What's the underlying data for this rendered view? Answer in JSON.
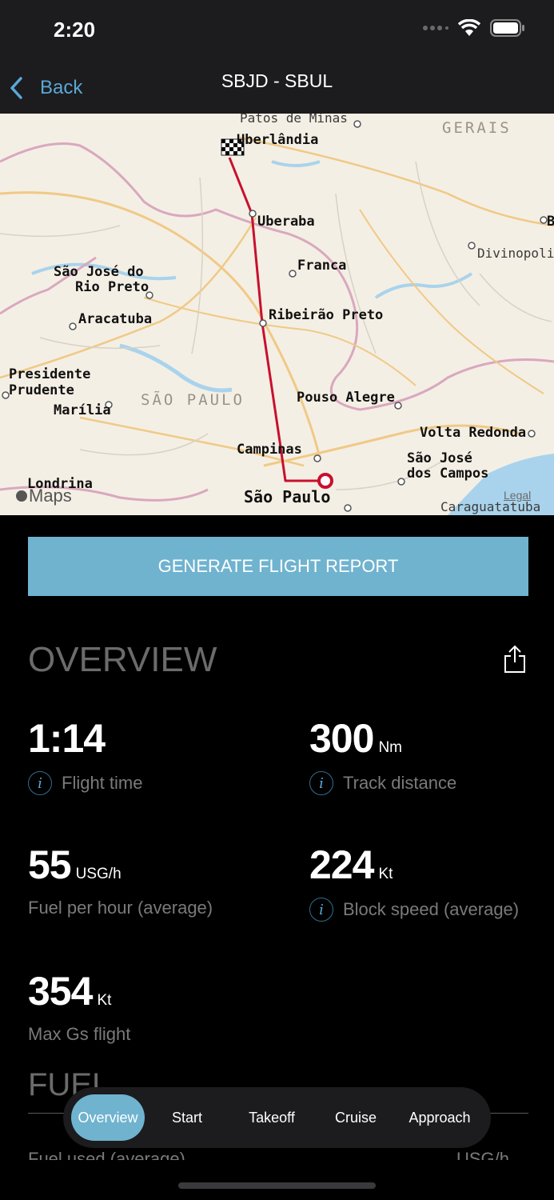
{
  "status_bar": {
    "time": "2:20"
  },
  "nav": {
    "back_label": "Back",
    "title": "SBJD - SBUL"
  },
  "map": {
    "labels": {
      "patos": "Patos de Minas",
      "gerais": "GERAIS",
      "uberlandia": "Uberlândia",
      "uberaba": "Uberaba",
      "divinopolis": "Divinopoli",
      "franca": "Franca",
      "sjrp_1": "São José do",
      "sjrp_2": "Rio Preto",
      "aracatuba": "Aracatuba",
      "ribeirao": "Ribeirão Preto",
      "presidente_1": "Presidente",
      "presidente_2": "Prudente",
      "sao_paulo_state": "SÃO PAULO",
      "pouso": "Pouso Alegre",
      "marilia": "Marília",
      "volta": "Volta Redonda",
      "campinas": "Campinas",
      "sjc_1": "São José",
      "sjc_2": "dos Campos",
      "londrina": "Londrina",
      "sao_paulo": "São Paulo",
      "caraguatatuba": "Caraguatatuba",
      "b_edge": "B"
    },
    "attribution": "Maps",
    "legal": "Legal"
  },
  "report_button": "GENERATE FLIGHT REPORT",
  "overview": {
    "title": "OVERVIEW",
    "stats": {
      "flight_time": {
        "value": "1:14",
        "label": "Flight time"
      },
      "track_distance": {
        "value": "300",
        "unit": "Nm",
        "label": "Track distance"
      },
      "fuel_per_hour": {
        "value": "55",
        "unit": "USG/h",
        "label": "Fuel per hour (average)"
      },
      "block_speed": {
        "value": "224",
        "unit": "Kt",
        "label": "Block speed (average)"
      },
      "max_gs": {
        "value": "354",
        "unit": "Kt",
        "label": "Max Gs flight"
      }
    }
  },
  "fuel": {
    "title": "FUEL",
    "row_label": "Fuel used (average)",
    "row_value": "USG/h"
  },
  "tabs": [
    "Overview",
    "Start",
    "Takeoff",
    "Cruise",
    "Approach"
  ],
  "colors": {
    "accent": "#6fb3cf",
    "route": "#c8102e",
    "background": "#000000"
  }
}
